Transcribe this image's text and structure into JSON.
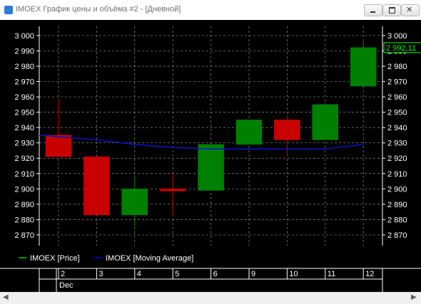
{
  "window": {
    "title": "IMOEX График цены и объёма #2 - [Дневной]",
    "minimize_icon": "minimize-icon",
    "maximize_icon": "restore-icon",
    "close_icon": "close-icon"
  },
  "chart_data": {
    "type": "candlestick",
    "ylim": [
      2863,
      3006
    ],
    "yticks": [
      2870,
      2880,
      2890,
      2900,
      2910,
      2920,
      2930,
      2940,
      2950,
      2960,
      2970,
      2980,
      2990,
      3000
    ],
    "ytick_labels": [
      "2 870",
      "2 880",
      "2 890",
      "2 900",
      "2 910",
      "2 920",
      "2 930",
      "2 940",
      "2 950",
      "2 960",
      "2 970",
      "2 980",
      "2 990",
      "3 000"
    ],
    "x_day_labels": [
      "2",
      "3",
      "4",
      "5",
      "6",
      "9",
      "10",
      "11",
      "12"
    ],
    "x_month_label": "Dec",
    "last_price_label": "2 992,11",
    "candles": [
      {
        "day": "2",
        "open": 2935,
        "high": 2959,
        "low": 2921,
        "close": 2921
      },
      {
        "day": "3",
        "open": 2921,
        "high": 2921,
        "low": 2883,
        "close": 2883
      },
      {
        "day": "4",
        "open": 2883,
        "high": 2909,
        "low": 2875,
        "close": 2900
      },
      {
        "day": "5",
        "open": 2900,
        "high": 2910,
        "low": 2882,
        "close": 2899
      },
      {
        "day": "6",
        "open": 2899,
        "high": 2929,
        "low": 2899,
        "close": 2929
      },
      {
        "day": "9",
        "open": 2929,
        "high": 2945,
        "low": 2929,
        "close": 2945
      },
      {
        "day": "10",
        "open": 2945,
        "high": 2948,
        "low": 2921,
        "close": 2932
      },
      {
        "day": "11",
        "open": 2932,
        "high": 2956,
        "low": 2932,
        "close": 2955
      },
      {
        "day": "12",
        "open": 2967,
        "high": 2997,
        "low": 2967,
        "close": 2992.11
      }
    ],
    "moving_average": {
      "name": "IMOEX [Moving Average]",
      "values": [
        2935,
        2932,
        2929,
        2927,
        2926,
        2926,
        2926,
        2926,
        2929
      ]
    },
    "legend": [
      {
        "name": "IMOEX [Price]",
        "color": "#00c800"
      },
      {
        "name": "IMOEX [Moving Average]",
        "color": "#0000ff"
      }
    ],
    "legend_position": "bottom-left",
    "grid": true,
    "colors": {
      "up": "#008000",
      "down": "#c80000",
      "grid": "#8c8c8c",
      "axis": "#ffffff",
      "moving_average": "#0a14c8",
      "last_price": "#00ff00"
    }
  }
}
